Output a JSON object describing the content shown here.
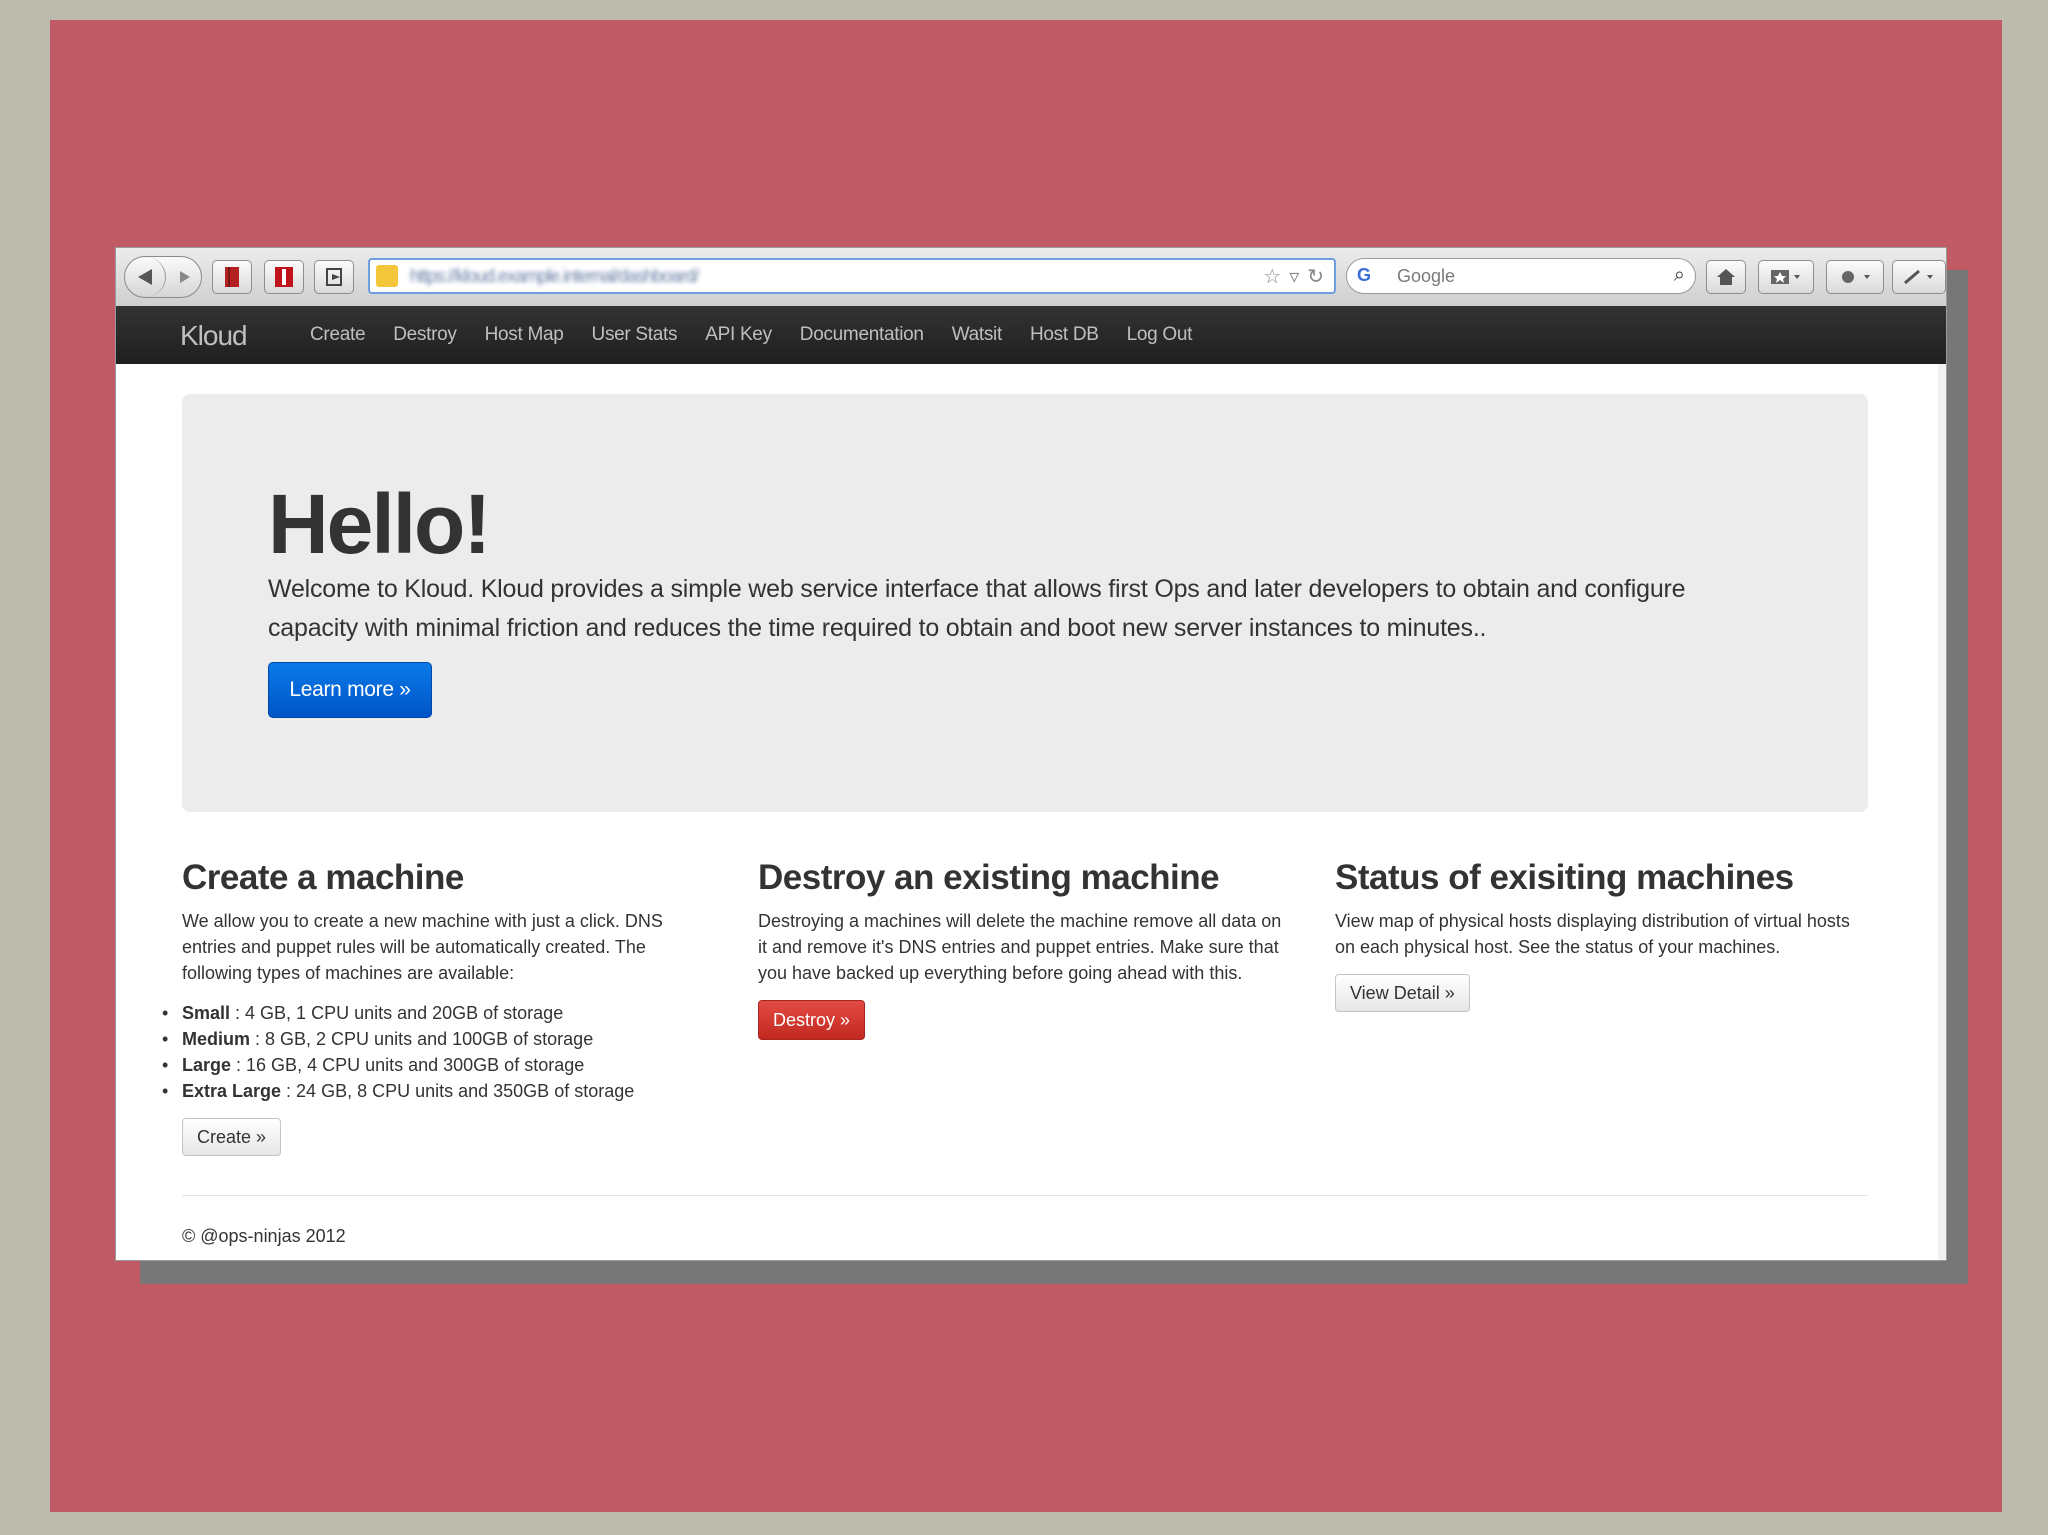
{
  "browser": {
    "url": "https://kloud.example.internal/dashboard/",
    "search_engine_label": "G",
    "search_placeholder": "Google"
  },
  "navbar": {
    "brand": "Kloud",
    "items": [
      "Create",
      "Destroy",
      "Host Map",
      "User Stats",
      "API Key",
      "Documentation",
      "Watsit",
      "Host DB",
      "Log Out"
    ]
  },
  "hero": {
    "title": "Hello!",
    "text": "Welcome to Kloud. Kloud provides a simple web service interface that allows first Ops and later developers to obtain and configure capacity with minimal friction and reduces the time required to obtain and boot new server instances to minutes..",
    "button": "Learn more »"
  },
  "columns": {
    "create": {
      "title": "Create a machine",
      "text": "We allow you to create a new machine with just a click. DNS entries and puppet rules will be automatically created. The following types of machines are available:",
      "types": [
        {
          "name": "Small",
          "spec": " : 4 GB, 1 CPU units and 20GB of storage"
        },
        {
          "name": "Medium",
          "spec": " : 8 GB, 2 CPU units and 100GB of storage"
        },
        {
          "name": "Large",
          "spec": " : 16 GB, 4 CPU units and 300GB of storage"
        },
        {
          "name": "Extra Large",
          "spec": " : 24 GB, 8 CPU units and 350GB of storage"
        }
      ],
      "button": "Create »"
    },
    "destroy": {
      "title": "Destroy an existing machine",
      "text": "Destroying a machines will delete the machine remove all data on it and remove it's DNS entries and puppet entries. Make sure that you have backed up everything before going ahead with this.",
      "button": "Destroy »"
    },
    "status": {
      "title": "Status of exisiting machines",
      "text": "View map of physical hosts displaying distribution of virtual hosts on each physical host. See the status of your machines.",
      "button": "View Detail »"
    }
  },
  "footer": "© @ops-ninjas 2012",
  "colors": {
    "frame": "#c05b66",
    "navbar": "#222222",
    "primary": "#0064d7",
    "danger": "#d0342c"
  }
}
